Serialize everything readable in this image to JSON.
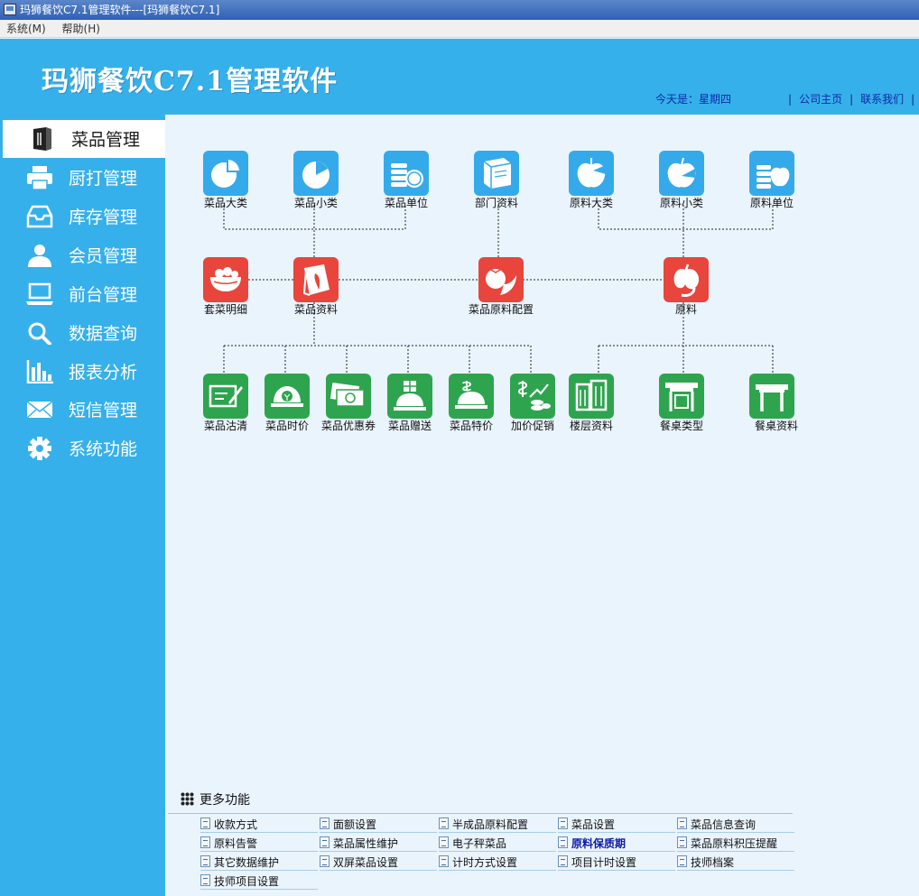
{
  "window": {
    "title": "玛狮餐饮C7.1管理软件---[玛狮餐饮C7.1]"
  },
  "menu": {
    "items": [
      "系统(M)",
      "帮助(H)"
    ]
  },
  "header": {
    "app_title": "玛狮餐饮C7.1管理软件",
    "date_label": "今天是：星期四",
    "links": [
      "公司主页",
      "联系我们"
    ]
  },
  "sidebar": {
    "items": [
      {
        "label": "菜品管理",
        "icon": "menu-book-icon",
        "active": true
      },
      {
        "label": "厨打管理",
        "icon": "printer-icon",
        "active": false
      },
      {
        "label": "库存管理",
        "icon": "inbox-icon",
        "active": false
      },
      {
        "label": "会员管理",
        "icon": "user-icon",
        "active": false
      },
      {
        "label": "前台管理",
        "icon": "laptop-icon",
        "active": false
      },
      {
        "label": "数据查询",
        "icon": "search-icon",
        "active": false
      },
      {
        "label": "报表分析",
        "icon": "bar-chart-icon",
        "active": false
      },
      {
        "label": "短信管理",
        "icon": "envelope-icon",
        "active": false
      },
      {
        "label": "系统功能",
        "icon": "gear-icon",
        "active": false
      }
    ]
  },
  "flow": {
    "row1": [
      {
        "label": "菜品大类",
        "icon": "pie-chart-icon",
        "color": "#35aaea"
      },
      {
        "label": "菜品小类",
        "icon": "pie-slice-icon",
        "color": "#35aaea"
      },
      {
        "label": "菜品单位",
        "icon": "coins-icon",
        "color": "#35aaea"
      },
      {
        "label": "部门资料",
        "icon": "book-icon",
        "color": "#35aaea"
      },
      {
        "label": "原料大类",
        "icon": "apple-pie-icon",
        "color": "#35aaea"
      },
      {
        "label": "原料小类",
        "icon": "apple-slice-icon",
        "color": "#35aaea"
      },
      {
        "label": "原料单位",
        "icon": "apple-coins-icon",
        "color": "#35aaea"
      }
    ],
    "row2": [
      {
        "label": "套菜明细",
        "icon": "salad-bowl-icon",
        "color": "#e8453c"
      },
      {
        "label": "菜品资料",
        "icon": "recipe-book-icon",
        "color": "#e8453c"
      },
      {
        "label": "菜品原料配置",
        "icon": "tomato-chili-icon",
        "color": "#e8453c"
      },
      {
        "label": "原料",
        "icon": "pepper-icon",
        "color": "#e8453c"
      }
    ],
    "row3": [
      {
        "label": "菜品沽清",
        "icon": "check-writing-icon",
        "color": "#2ea44f"
      },
      {
        "label": "菜品时价",
        "icon": "price-dish-icon",
        "color": "#2ea44f"
      },
      {
        "label": "菜品优惠券",
        "icon": "money-bills-icon",
        "color": "#2ea44f"
      },
      {
        "label": "菜品赠送",
        "icon": "gift-dish-icon",
        "color": "#2ea44f"
      },
      {
        "label": "菜品特价",
        "icon": "special-price-icon",
        "color": "#2ea44f"
      },
      {
        "label": "加价促销",
        "icon": "promotion-chart-icon",
        "color": "#2ea44f"
      },
      {
        "label": "楼层资料",
        "icon": "building-icon",
        "color": "#2ea44f"
      },
      {
        "label": "餐桌类型",
        "icon": "table-type-icon",
        "color": "#2ea44f"
      },
      {
        "label": "餐桌资料",
        "icon": "table-icon",
        "color": "#2ea44f"
      }
    ]
  },
  "more": {
    "title": "更多功能",
    "items": [
      {
        "label": "收款方式",
        "highlight": false
      },
      {
        "label": "面额设置",
        "highlight": false
      },
      {
        "label": "半成品原料配置",
        "highlight": false
      },
      {
        "label": "菜品设置",
        "highlight": false
      },
      {
        "label": "菜品信息查询",
        "highlight": false
      },
      {
        "label": "原料告警",
        "highlight": false
      },
      {
        "label": "菜品属性维护",
        "highlight": false
      },
      {
        "label": "电子秤菜品",
        "highlight": false
      },
      {
        "label": "原料保质期",
        "highlight": true
      },
      {
        "label": "菜品原料积压提醒",
        "highlight": false
      },
      {
        "label": "其它数据维护",
        "highlight": false
      },
      {
        "label": "双屏菜品设置",
        "highlight": false
      },
      {
        "label": "计时方式设置",
        "highlight": false
      },
      {
        "label": "项目计时设置",
        "highlight": false
      },
      {
        "label": "技师档案",
        "highlight": false
      },
      {
        "label": "技师项目设置",
        "highlight": false
      }
    ]
  }
}
